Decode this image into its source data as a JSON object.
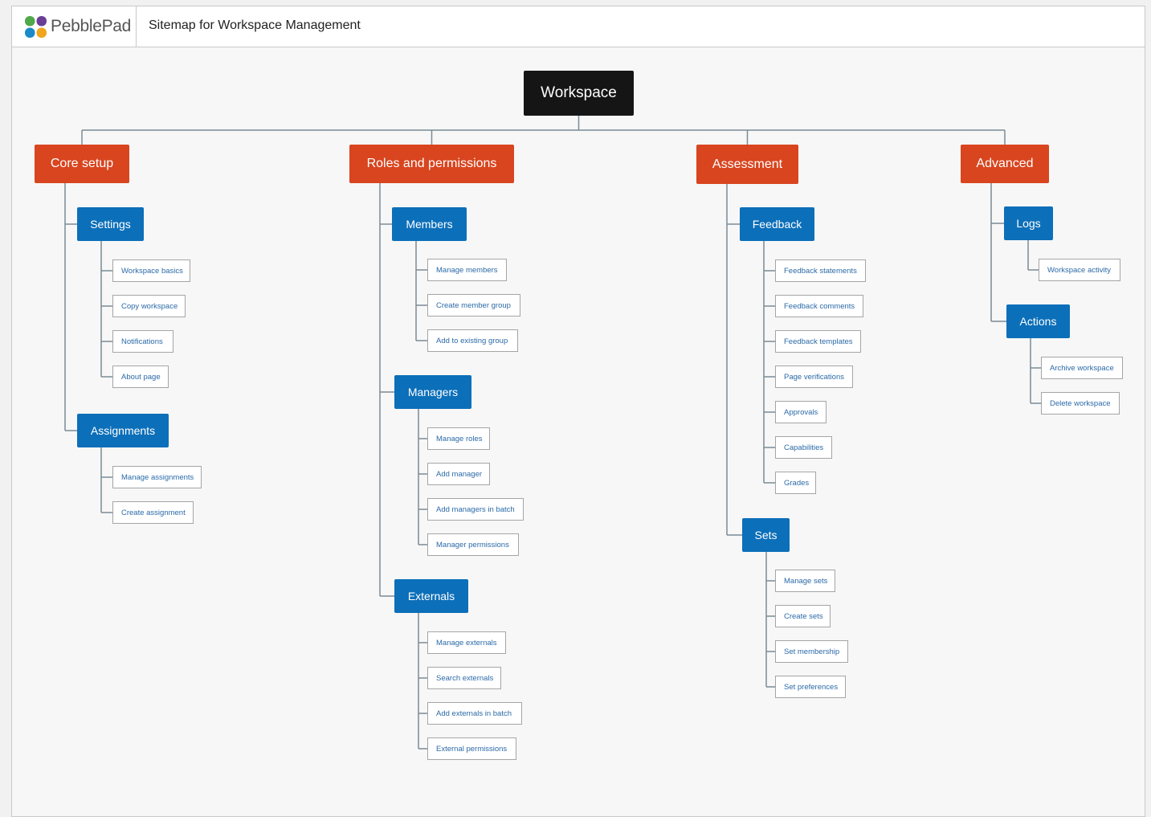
{
  "header": {
    "brand": "PebblePad",
    "title": "Sitemap for Workspace Management"
  },
  "root": "Workspace",
  "colors": {
    "root": "#151515",
    "category": "#d8451f",
    "section": "#0c6fb9",
    "leaf_text": "#2b6aa8",
    "line": "#7a8a96"
  },
  "logo_colors": [
    "#4fa84a",
    "#6a3e96",
    "#1a8ac8",
    "#f0a51c"
  ],
  "categories": [
    {
      "label": "Core setup",
      "sections": [
        {
          "label": "Settings",
          "items": [
            "Workspace basics",
            "Copy workspace",
            "Notifications",
            "About page"
          ]
        },
        {
          "label": "Assignments",
          "items": [
            "Manage assignments",
            "Create assignment"
          ]
        }
      ]
    },
    {
      "label": "Roles and permissions",
      "sections": [
        {
          "label": "Members",
          "items": [
            "Manage members",
            "Create member group",
            "Add to existing group"
          ]
        },
        {
          "label": "Managers",
          "items": [
            "Manage roles",
            "Add manager",
            "Add managers in batch",
            "Manager permissions"
          ]
        },
        {
          "label": "Externals",
          "items": [
            "Manage externals",
            "Search externals",
            "Add externals in batch",
            "External permissions"
          ]
        }
      ]
    },
    {
      "label": "Assessment",
      "sections": [
        {
          "label": "Feedback",
          "items": [
            "Feedback statements",
            "Feedback comments",
            "Feedback templates",
            "Page verifications",
            "Approvals",
            "Capabilities",
            "Grades"
          ]
        },
        {
          "label": "Sets",
          "items": [
            "Manage sets",
            "Create sets",
            "Set membership",
            "Set preferences"
          ]
        }
      ]
    },
    {
      "label": "Advanced",
      "sections": [
        {
          "label": "Logs",
          "items": [
            "Workspace activity"
          ]
        },
        {
          "label": "Actions",
          "items": [
            "Archive workspace",
            "Delete workspace"
          ]
        }
      ]
    }
  ]
}
